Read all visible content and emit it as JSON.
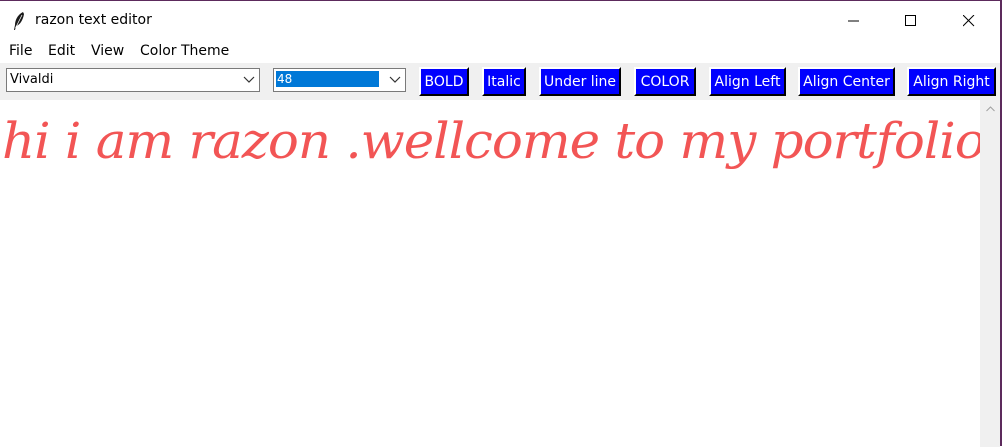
{
  "window": {
    "title": "razon text editor"
  },
  "menu": {
    "items": [
      "File",
      "Edit",
      "View",
      "Color Theme"
    ]
  },
  "toolbar": {
    "font_family": "Vivaldi",
    "font_size": "48",
    "buttons": {
      "bold": "BOLD",
      "italic": "Italic",
      "underline": "Under line",
      "color": "COLOR",
      "align_left": "Align Left",
      "align_center": "Align Center",
      "align_right": "Align Right"
    }
  },
  "editor": {
    "content": "hi i am razon .wellcome to my portfolio",
    "text_color": "#f25555"
  },
  "colors": {
    "button_bg": "#0000ff",
    "button_text": "#ffffff",
    "selection": "#0078d7"
  }
}
